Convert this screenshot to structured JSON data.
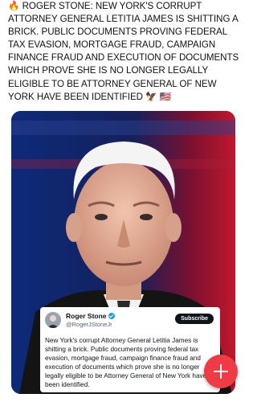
{
  "post": {
    "lead_emoji": "🔥",
    "text": "ROGER STONE: NEW YORK'S CORRUPT ATTORNEY GENERAL LETITIA JAMES IS SHITTING A BRICK. PUBLIC DOCUMENTS PROVING FEDERAL TAX EVASION, MORTGAGE FRAUD, CAMPAIGN FINANCE FRAUD AND EXECUTION OF DOCUMENTS WHICH PROVE SHE IS NO LONGER LEGALLY ELIGIBLE TO BE ATTORNEY GENERAL OF NEW YORK HAVE BEEN IDENTIFIED",
    "trail_emojis": "🦅 🇺🇸"
  },
  "embedded_post": {
    "name": "Roger Stone",
    "handle": "@RogerJStoneJr",
    "subscribe_label": "Subscribe",
    "body": "New York's corrupt Attorney General Letitia James is shitting a brick. Public documents proving federal tax evasion, mortgage fraud, campaign finance fraud and execution of documents which prove she is no longer legally eligible to be Attorney General of New York have been identified."
  },
  "icons": {
    "fab": "plus-icon",
    "verified": "verified-badge-icon"
  },
  "colors": {
    "fab": "#ee3b46",
    "verified": "#1d9bf0",
    "subscribe_bg": "#0f1419"
  }
}
